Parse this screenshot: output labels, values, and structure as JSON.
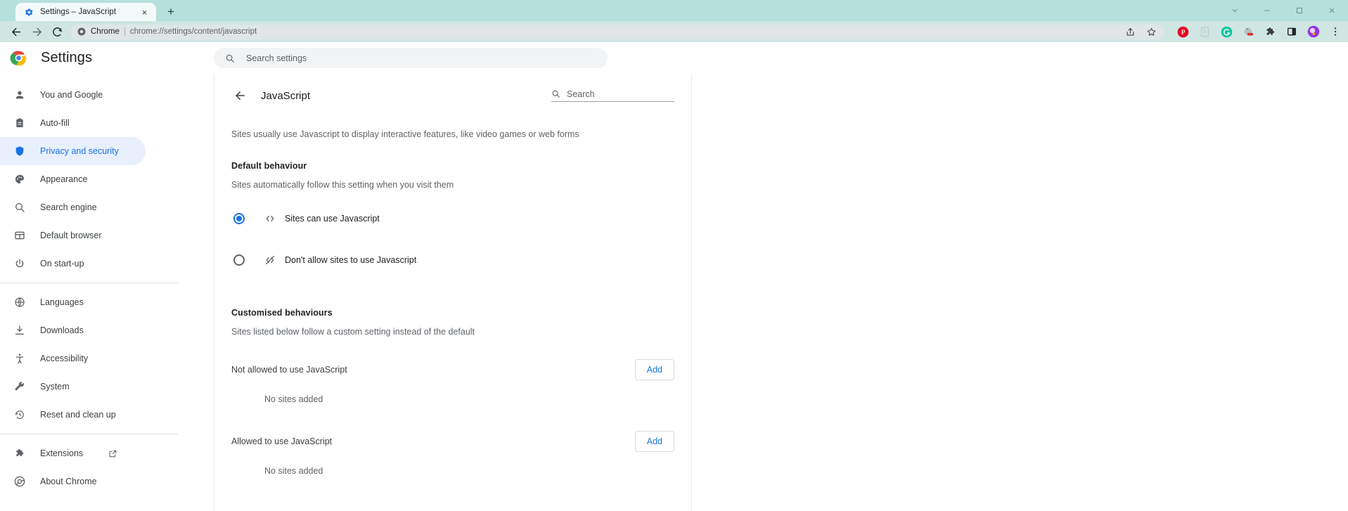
{
  "window": {
    "tab": {
      "title": "Settings – JavaScript",
      "favicon": "gear-icon",
      "close_label": "×"
    },
    "new_tab_label": "+",
    "controls": [
      {
        "name": "tab-search",
        "glyph": "⌄"
      },
      {
        "name": "minimize",
        "glyph": "—"
      },
      {
        "name": "maximize",
        "glyph": "❐"
      },
      {
        "name": "close",
        "glyph": "✕"
      }
    ]
  },
  "toolbar": {
    "back_label": "←",
    "forward_label": "→",
    "reload_label": "↻",
    "omnibox": {
      "chip": "Chrome",
      "url_prefix": "chrome://",
      "url_bold": "settings",
      "url_suffix": "/content/javascript",
      "full_url": "chrome://settings/content/javascript"
    },
    "actions": [
      {
        "name": "share-icon"
      },
      {
        "name": "bookmark-star-icon"
      }
    ],
    "extensions": [
      {
        "name": "pinterest-extension-icon",
        "color": "#e60023",
        "letter": "P"
      },
      {
        "name": "clipboard-extension-icon",
        "color": "#d8d8d8",
        "letter": ""
      },
      {
        "name": "grammarly-extension-icon",
        "color": "#15c39a",
        "letter": "G"
      },
      {
        "name": "tomato-timer-extension-icon",
        "color": "#d93025",
        "letter": ""
      },
      {
        "name": "puzzle-extensions-icon",
        "color": "#3c4043",
        "letter": ""
      },
      {
        "name": "side-panel-icon",
        "color": "#202124",
        "letter": ""
      },
      {
        "name": "profile-avatar-icon",
        "color": "#9334e6",
        "letter": ""
      },
      {
        "name": "chrome-menu-icon",
        "color": "#3c4043",
        "letter": ""
      }
    ]
  },
  "settings": {
    "brand_title": "Settings",
    "search": {
      "placeholder": "Search settings",
      "value": ""
    }
  },
  "sidebar": {
    "groups": [
      {
        "items": [
          {
            "label": "You and Google",
            "icon": "person-icon",
            "active": false
          },
          {
            "label": "Auto-fill",
            "icon": "clipboard-icon",
            "active": false
          },
          {
            "label": "Privacy and security",
            "icon": "shield-icon",
            "active": true
          },
          {
            "label": "Appearance",
            "icon": "palette-icon",
            "active": false
          },
          {
            "label": "Search engine",
            "icon": "search-icon",
            "active": false
          },
          {
            "label": "Default browser",
            "icon": "browser-window-icon",
            "active": false
          },
          {
            "label": "On start-up",
            "icon": "power-icon",
            "active": false
          }
        ]
      },
      {
        "items": [
          {
            "label": "Languages",
            "icon": "globe-icon",
            "active": false
          },
          {
            "label": "Downloads",
            "icon": "download-icon",
            "active": false
          },
          {
            "label": "Accessibility",
            "icon": "accessibility-icon",
            "active": false
          },
          {
            "label": "System",
            "icon": "wrench-icon",
            "active": false
          },
          {
            "label": "Reset and clean up",
            "icon": "history-restore-icon",
            "active": false
          }
        ]
      },
      {
        "items": [
          {
            "label": "Extensions",
            "icon": "puzzle-icon",
            "active": false,
            "external": true
          },
          {
            "label": "About Chrome",
            "icon": "chrome-logo-icon",
            "active": false
          }
        ]
      }
    ]
  },
  "main": {
    "back_label": "←",
    "title": "JavaScript",
    "search": {
      "placeholder": "Search",
      "value": ""
    },
    "description": "Sites usually use Javascript to display interactive features, like video games or web forms",
    "default_behaviour": {
      "title": "Default behaviour",
      "subtitle": "Sites automatically follow this setting when you visit them",
      "options": [
        {
          "label": "Sites can use Javascript",
          "icon": "code-brackets-icon",
          "selected": true
        },
        {
          "label": "Don't allow sites to use Javascript",
          "icon": "code-brackets-slashed-icon",
          "selected": false
        }
      ]
    },
    "customised_behaviours": {
      "title": "Customised behaviours",
      "subtitle": "Sites listed below follow a custom setting instead of the default",
      "lists": [
        {
          "label": "Not allowed to use JavaScript",
          "add_label": "Add",
          "empty_text": "No sites added"
        },
        {
          "label": "Allowed to use JavaScript",
          "add_label": "Add",
          "empty_text": "No sites added"
        }
      ]
    }
  },
  "colors": {
    "window_tint": "#b5e0dc",
    "toolbar_tint": "#cfe6e3",
    "accent": "#1a73e8",
    "active_pill": "#e8f0fe",
    "text_primary": "#202124",
    "text_secondary": "#5f6368"
  }
}
